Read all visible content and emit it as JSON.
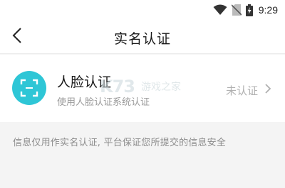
{
  "status_bar": {
    "time": "9:29",
    "icons": [
      "wifi-icon",
      "no-sim-icon",
      "battery-charging-icon"
    ]
  },
  "header": {
    "title": "实名认证",
    "back_icon": "back-arrow-icon"
  },
  "verification_item": {
    "icon": "face-scan-icon",
    "title": "人脸认证",
    "subtitle": "使用人脸认证系统认证",
    "status": "未认证",
    "chevron": "chevron-right-icon"
  },
  "watermark": {
    "logo": "K73",
    "text": "游戏之家"
  },
  "notice": "信息仅用作实名认证, 平台保证您所提交的信息安全",
  "colors": {
    "accent": "#2ec6d6",
    "background": "#f4f4f4",
    "card": "#ffffff",
    "muted_text": "#9a9a9a"
  }
}
